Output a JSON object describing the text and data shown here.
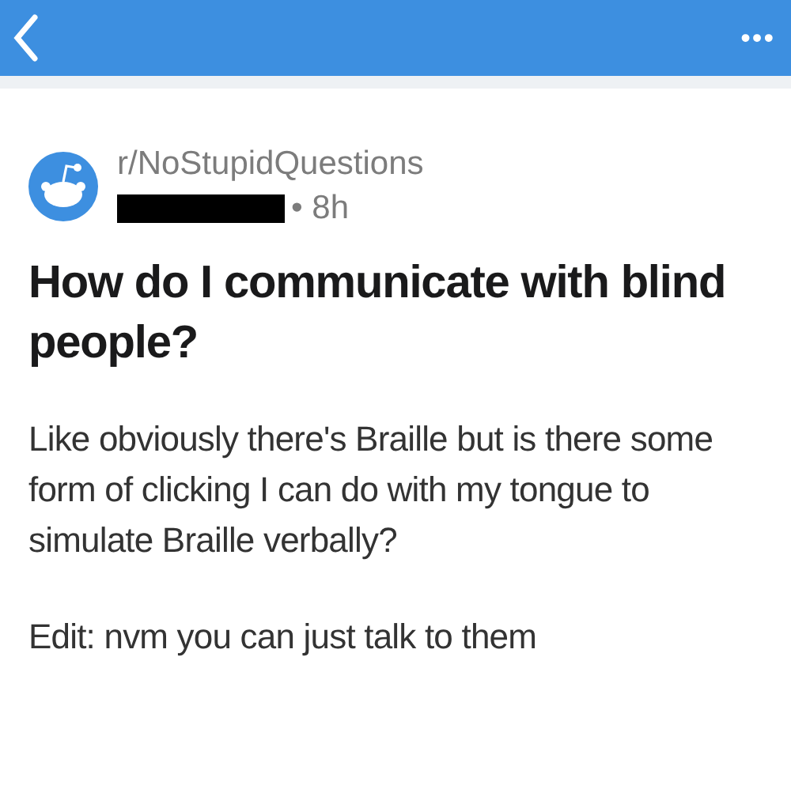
{
  "header": {
    "more": "•••"
  },
  "post": {
    "subreddit": "r/NoStupidQuestions",
    "author_redacted": true,
    "age": "• 8h",
    "title": "How do I communicate with blind people?",
    "body": "Like obviously there's Braille but is there some form of clicking I can do with my tongue to simulate Braille verbally?",
    "edit": "Edit: nvm you can just talk to them"
  }
}
